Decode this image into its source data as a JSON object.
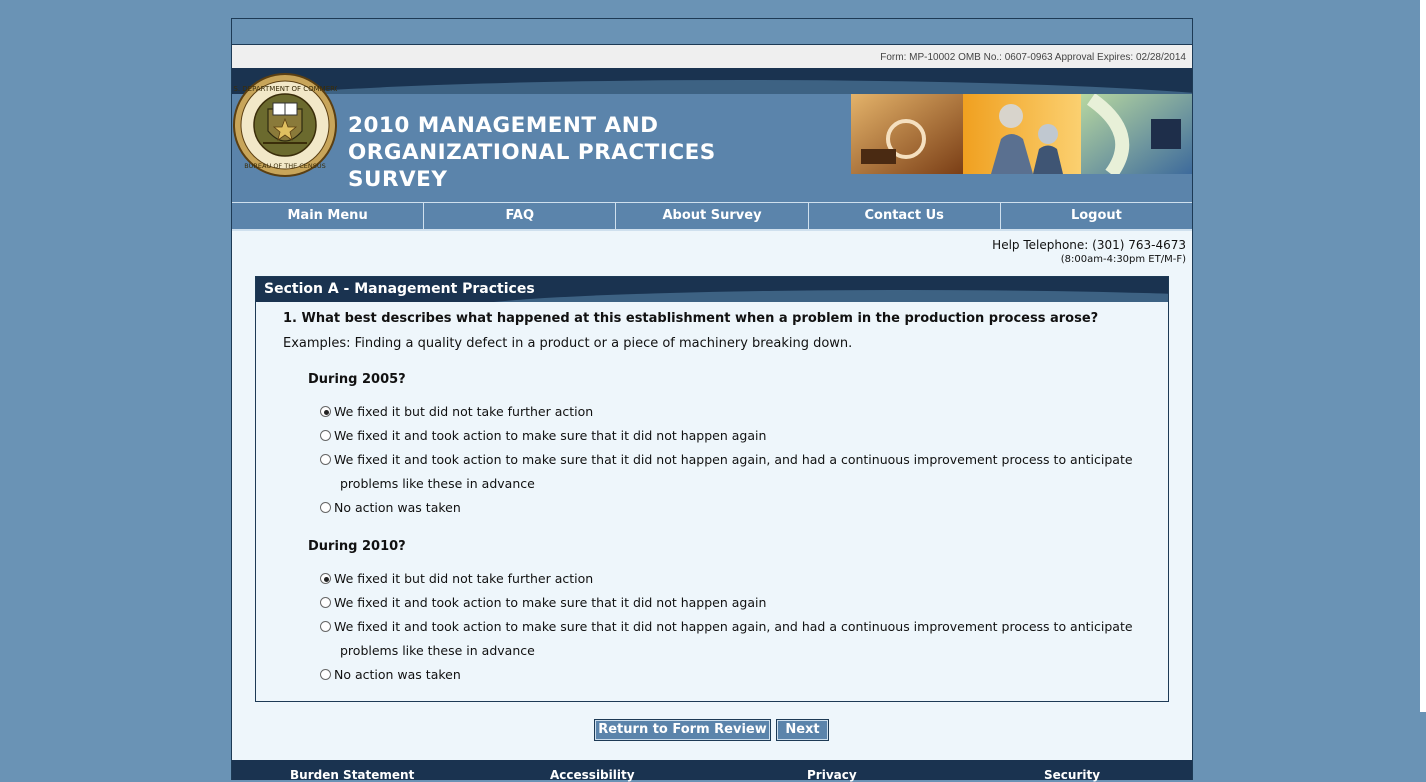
{
  "form_info": "Form: MP-10002 OMB No.: 0607-0963 Approval Expires: 02/28/2014",
  "header": {
    "title_line1": "2010 MANAGEMENT AND",
    "title_line2": "ORGANIZATIONAL PRACTICES",
    "title_line3": "SURVEY",
    "seal_text_top": "U.S. DEPARTMENT OF COMMERCE",
    "seal_text_bottom": "BUREAU OF THE CENSUS"
  },
  "nav": [
    "Main Menu",
    "FAQ",
    "About Survey",
    "Contact Us",
    "Logout"
  ],
  "help": {
    "telephone": "Help Telephone: (301) 763-4673",
    "hours": "(8:00am-4:30pm ET/M-F)"
  },
  "section": {
    "title": "Section A - Management Practices",
    "question": "1. What best describes what happened at this establishment when a problem in the production process arose?",
    "examples": "Examples: Finding a quality defect in a product or a piece of machinery breaking down.",
    "periods": [
      {
        "label": "During 2005?",
        "selected_index": 0,
        "options": [
          "We fixed it but did not take further action",
          "We fixed it and took action to make sure that it did not happen again",
          "We fixed it and took action to make sure that it did not happen again, and had a continuous improvement process to anticipate",
          "No action was taken"
        ],
        "option3_cont": "problems like these in advance"
      },
      {
        "label": "During 2010?",
        "selected_index": 0,
        "options": [
          "We fixed it but did not take further action",
          "We fixed it and took action to make sure that it did not happen again",
          "We fixed it and took action to make sure that it did not happen again, and had a continuous improvement process to anticipate",
          "No action was taken"
        ],
        "option3_cont": "problems like these in advance"
      }
    ]
  },
  "buttons": {
    "return": "Return to Form Review",
    "next": "Next"
  },
  "footer": [
    "Burden Statement",
    "Accessibility",
    "Privacy",
    "Security"
  ],
  "colors": {
    "background": "#6a93b5",
    "dark_band": "#1a3350",
    "header": "#5b84ab"
  }
}
